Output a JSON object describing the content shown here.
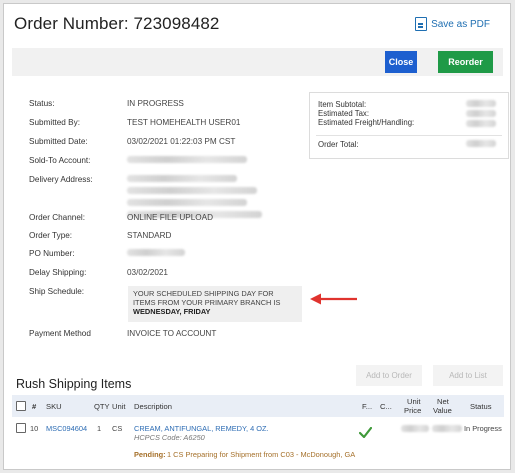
{
  "header": {
    "title": "Order Number: 723098482",
    "save_pdf_label": "Save as PDF"
  },
  "toolbar": {
    "close_label": "Close",
    "reorder_label": "Reorder"
  },
  "colors": {
    "close_button": "#1d5fcf",
    "reorder_button": "#1f9a47",
    "link": "#2e6db4",
    "pending": "#a5702a",
    "arrow": "#e0332e"
  },
  "fields": [
    {
      "label": "Status:",
      "value": "IN PROGRESS"
    },
    {
      "label": "Submitted By:",
      "value": "TEST HOMEHEALTH USER01"
    },
    {
      "label": "Submitted Date:",
      "value": "03/02/2021 01:22:03 PM CST"
    },
    {
      "label": "Sold-To Account:",
      "value": ""
    },
    {
      "label": "Delivery Address:",
      "value": ""
    },
    {
      "label": "Order Channel:",
      "value": "ONLINE FILE UPLOAD"
    },
    {
      "label": "Order Type:",
      "value": "STANDARD"
    },
    {
      "label": "PO Number:",
      "value": ""
    },
    {
      "label": "Delay Shipping:",
      "value": "03/02/2021"
    },
    {
      "label": "Ship Schedule:",
      "value": ""
    },
    {
      "label": "Payment Method",
      "value": "INVOICE TO ACCOUNT"
    }
  ],
  "ship_schedule": {
    "text": "YOUR SCHEDULED SHIPPING DAY FOR ITEMS FROM YOUR PRIMARY BRANCH IS",
    "days": "WEDNESDAY, FRIDAY"
  },
  "totals": {
    "item_subtotal_label": "Item Subtotal:",
    "estimated_tax_label": "Estimated Tax:",
    "estimated_freight_label": "Estimated Freight/Handling:",
    "order_total_label": "Order Total:"
  },
  "list_actions": {
    "add_to_order_label": "Add to Order",
    "add_to_list_label": "Add to List"
  },
  "rush_section": {
    "title": "Rush Shipping Items",
    "columns": {
      "num": "#",
      "sku": "SKU",
      "qty": "QTY",
      "unit": "Unit",
      "description": "Description",
      "f": "F...",
      "c": "C...",
      "unit_price_1": "Unit",
      "unit_price_2": "Price",
      "net_value_1": "Net",
      "net_value_2": "Value",
      "status": "Status"
    },
    "rows": [
      {
        "num": "10",
        "sku": "MSC094604",
        "qty": "1",
        "unit": "CS",
        "description": "CREAM, ANTIFUNGAL, REMEDY, 4 OZ.",
        "hcpcs": "HCPCS Code: A6250",
        "pending_label": "Pending:",
        "pending_text": "1 CS Preparing for Shipment from C03 - McDonough, GA",
        "status": "In Progress"
      }
    ]
  }
}
